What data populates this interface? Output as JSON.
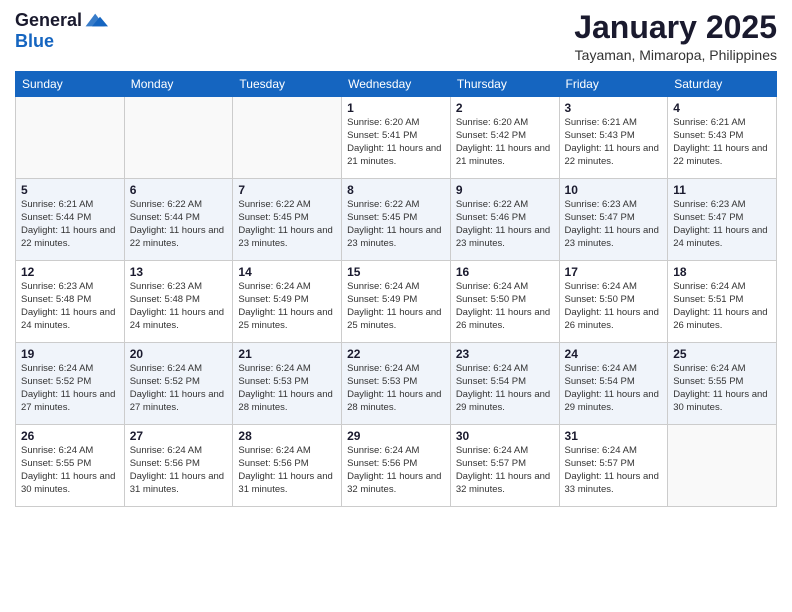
{
  "header": {
    "logo": {
      "general": "General",
      "blue": "Blue"
    },
    "title": "January 2025",
    "location": "Tayaman, Mimaropa, Philippines"
  },
  "calendar": {
    "weekdays": [
      "Sunday",
      "Monday",
      "Tuesday",
      "Wednesday",
      "Thursday",
      "Friday",
      "Saturday"
    ],
    "weeks": [
      [
        {
          "day": "",
          "sunrise": "",
          "sunset": "",
          "daylight": ""
        },
        {
          "day": "",
          "sunrise": "",
          "sunset": "",
          "daylight": ""
        },
        {
          "day": "",
          "sunrise": "",
          "sunset": "",
          "daylight": ""
        },
        {
          "day": "1",
          "sunrise": "Sunrise: 6:20 AM",
          "sunset": "Sunset: 5:41 PM",
          "daylight": "Daylight: 11 hours and 21 minutes."
        },
        {
          "day": "2",
          "sunrise": "Sunrise: 6:20 AM",
          "sunset": "Sunset: 5:42 PM",
          "daylight": "Daylight: 11 hours and 21 minutes."
        },
        {
          "day": "3",
          "sunrise": "Sunrise: 6:21 AM",
          "sunset": "Sunset: 5:43 PM",
          "daylight": "Daylight: 11 hours and 22 minutes."
        },
        {
          "day": "4",
          "sunrise": "Sunrise: 6:21 AM",
          "sunset": "Sunset: 5:43 PM",
          "daylight": "Daylight: 11 hours and 22 minutes."
        }
      ],
      [
        {
          "day": "5",
          "sunrise": "Sunrise: 6:21 AM",
          "sunset": "Sunset: 5:44 PM",
          "daylight": "Daylight: 11 hours and 22 minutes."
        },
        {
          "day": "6",
          "sunrise": "Sunrise: 6:22 AM",
          "sunset": "Sunset: 5:44 PM",
          "daylight": "Daylight: 11 hours and 22 minutes."
        },
        {
          "day": "7",
          "sunrise": "Sunrise: 6:22 AM",
          "sunset": "Sunset: 5:45 PM",
          "daylight": "Daylight: 11 hours and 23 minutes."
        },
        {
          "day": "8",
          "sunrise": "Sunrise: 6:22 AM",
          "sunset": "Sunset: 5:45 PM",
          "daylight": "Daylight: 11 hours and 23 minutes."
        },
        {
          "day": "9",
          "sunrise": "Sunrise: 6:22 AM",
          "sunset": "Sunset: 5:46 PM",
          "daylight": "Daylight: 11 hours and 23 minutes."
        },
        {
          "day": "10",
          "sunrise": "Sunrise: 6:23 AM",
          "sunset": "Sunset: 5:47 PM",
          "daylight": "Daylight: 11 hours and 23 minutes."
        },
        {
          "day": "11",
          "sunrise": "Sunrise: 6:23 AM",
          "sunset": "Sunset: 5:47 PM",
          "daylight": "Daylight: 11 hours and 24 minutes."
        }
      ],
      [
        {
          "day": "12",
          "sunrise": "Sunrise: 6:23 AM",
          "sunset": "Sunset: 5:48 PM",
          "daylight": "Daylight: 11 hours and 24 minutes."
        },
        {
          "day": "13",
          "sunrise": "Sunrise: 6:23 AM",
          "sunset": "Sunset: 5:48 PM",
          "daylight": "Daylight: 11 hours and 24 minutes."
        },
        {
          "day": "14",
          "sunrise": "Sunrise: 6:24 AM",
          "sunset": "Sunset: 5:49 PM",
          "daylight": "Daylight: 11 hours and 25 minutes."
        },
        {
          "day": "15",
          "sunrise": "Sunrise: 6:24 AM",
          "sunset": "Sunset: 5:49 PM",
          "daylight": "Daylight: 11 hours and 25 minutes."
        },
        {
          "day": "16",
          "sunrise": "Sunrise: 6:24 AM",
          "sunset": "Sunset: 5:50 PM",
          "daylight": "Daylight: 11 hours and 26 minutes."
        },
        {
          "day": "17",
          "sunrise": "Sunrise: 6:24 AM",
          "sunset": "Sunset: 5:50 PM",
          "daylight": "Daylight: 11 hours and 26 minutes."
        },
        {
          "day": "18",
          "sunrise": "Sunrise: 6:24 AM",
          "sunset": "Sunset: 5:51 PM",
          "daylight": "Daylight: 11 hours and 26 minutes."
        }
      ],
      [
        {
          "day": "19",
          "sunrise": "Sunrise: 6:24 AM",
          "sunset": "Sunset: 5:52 PM",
          "daylight": "Daylight: 11 hours and 27 minutes."
        },
        {
          "day": "20",
          "sunrise": "Sunrise: 6:24 AM",
          "sunset": "Sunset: 5:52 PM",
          "daylight": "Daylight: 11 hours and 27 minutes."
        },
        {
          "day": "21",
          "sunrise": "Sunrise: 6:24 AM",
          "sunset": "Sunset: 5:53 PM",
          "daylight": "Daylight: 11 hours and 28 minutes."
        },
        {
          "day": "22",
          "sunrise": "Sunrise: 6:24 AM",
          "sunset": "Sunset: 5:53 PM",
          "daylight": "Daylight: 11 hours and 28 minutes."
        },
        {
          "day": "23",
          "sunrise": "Sunrise: 6:24 AM",
          "sunset": "Sunset: 5:54 PM",
          "daylight": "Daylight: 11 hours and 29 minutes."
        },
        {
          "day": "24",
          "sunrise": "Sunrise: 6:24 AM",
          "sunset": "Sunset: 5:54 PM",
          "daylight": "Daylight: 11 hours and 29 minutes."
        },
        {
          "day": "25",
          "sunrise": "Sunrise: 6:24 AM",
          "sunset": "Sunset: 5:55 PM",
          "daylight": "Daylight: 11 hours and 30 minutes."
        }
      ],
      [
        {
          "day": "26",
          "sunrise": "Sunrise: 6:24 AM",
          "sunset": "Sunset: 5:55 PM",
          "daylight": "Daylight: 11 hours and 30 minutes."
        },
        {
          "day": "27",
          "sunrise": "Sunrise: 6:24 AM",
          "sunset": "Sunset: 5:56 PM",
          "daylight": "Daylight: 11 hours and 31 minutes."
        },
        {
          "day": "28",
          "sunrise": "Sunrise: 6:24 AM",
          "sunset": "Sunset: 5:56 PM",
          "daylight": "Daylight: 11 hours and 31 minutes."
        },
        {
          "day": "29",
          "sunrise": "Sunrise: 6:24 AM",
          "sunset": "Sunset: 5:56 PM",
          "daylight": "Daylight: 11 hours and 32 minutes."
        },
        {
          "day": "30",
          "sunrise": "Sunrise: 6:24 AM",
          "sunset": "Sunset: 5:57 PM",
          "daylight": "Daylight: 11 hours and 32 minutes."
        },
        {
          "day": "31",
          "sunrise": "Sunrise: 6:24 AM",
          "sunset": "Sunset: 5:57 PM",
          "daylight": "Daylight: 11 hours and 33 minutes."
        },
        {
          "day": "",
          "sunrise": "",
          "sunset": "",
          "daylight": ""
        }
      ]
    ]
  }
}
